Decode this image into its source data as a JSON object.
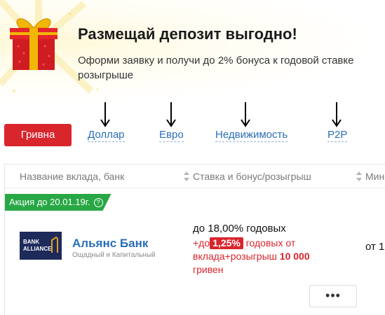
{
  "promo": {
    "title": "Размещай депозит выгодно!",
    "subtitle_line1": "Оформи заявку и получи до 2% бонуса к годовой ставке",
    "subtitle_line2": "розыгрыше"
  },
  "tabs": [
    {
      "label": "Гривна",
      "active": true
    },
    {
      "label": "Доллар",
      "active": false
    },
    {
      "label": "Евро",
      "active": false
    },
    {
      "label": "Недвижимость",
      "active": false
    },
    {
      "label": "P2P",
      "active": false
    }
  ],
  "table": {
    "headers": [
      "Название вклада, банк",
      "Ставка и бонус/розыгрыш",
      "Мин"
    ],
    "promo_ribbon": "Акция до 20.01.19г.",
    "row": {
      "bank_logo_text": [
        "BANK",
        "ALLIANCE"
      ],
      "bank_name": "Альянс Банк",
      "deposit_types": "Ощадный и Капитальный",
      "rate_main": "до 18,00% годовых",
      "bonus_prefix": "+до",
      "bonus_rate": "1,25%",
      "bonus_suffix": "годовых от",
      "bonus_line2": "вклада+розыгрыш",
      "bonus_amount": "10 000",
      "bonus_line3": "гривен",
      "min_amount": "от 1",
      "more_label": "•••"
    }
  },
  "colors": {
    "accent_red": "#d9252c",
    "link_blue": "#2a6eb8",
    "promo_green": "#28a745"
  }
}
